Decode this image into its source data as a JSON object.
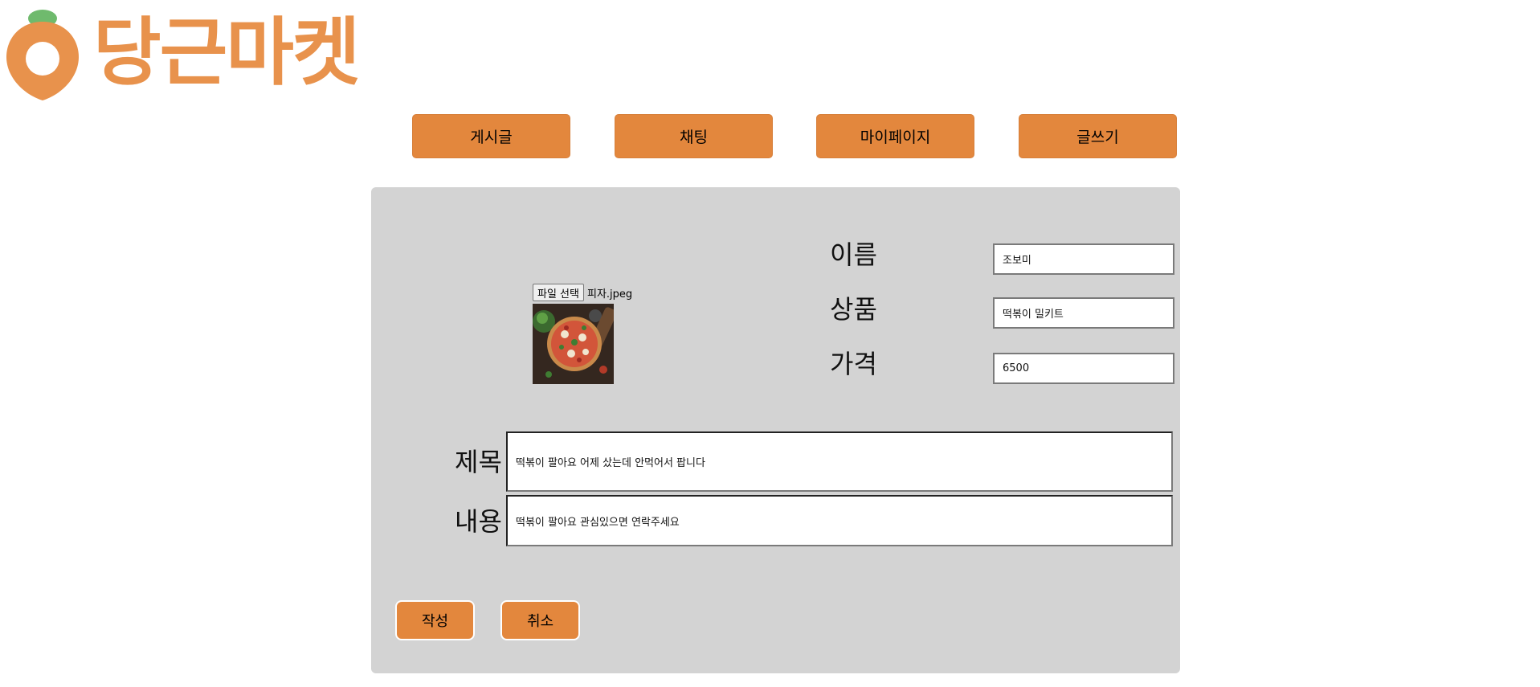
{
  "brand": {
    "name": "당근마켓",
    "accent": "#e3873d",
    "logo_color": "#e8924c",
    "leaf_color": "#6fba6d"
  },
  "nav": {
    "items": [
      "게시글",
      "채팅",
      "마이페이지",
      "글쓰기"
    ]
  },
  "form": {
    "file": {
      "button_label": "파일 선택",
      "file_name": "피자.jpeg"
    },
    "name": {
      "label": "이름",
      "value": "조보미"
    },
    "product": {
      "label": "상품",
      "value": "떡볶이 밀키트"
    },
    "price": {
      "label": "가격",
      "value": "6500"
    },
    "title": {
      "label": "제목",
      "value": "떡볶이 팔아요 어제 샀는데 안먹어서 팝니다"
    },
    "content": {
      "label": "내용",
      "value": "떡볶이 팔아요 관심있으면 연락주세요"
    },
    "submit_label": "작성",
    "cancel_label": "취소"
  },
  "panel_color": "#d3d3d3"
}
